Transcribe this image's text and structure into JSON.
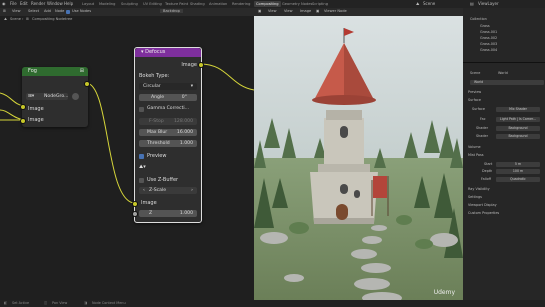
{
  "menu": [
    "File",
    "Edit",
    "Render",
    "Window",
    "Help"
  ],
  "workspaces": [
    "Layout",
    "Modeling",
    "Sculpting",
    "UV Editing",
    "Texture Paint",
    "Shading",
    "Animation",
    "Rendering",
    "Compositing",
    "Geometry Nodes",
    "Scripting"
  ],
  "active_workspace": "Compositing",
  "scene_name": "Scene",
  "view_layer_name": "ViewLayer",
  "node_header": {
    "editor_menus": [
      "View",
      "Select",
      "Add",
      "Node"
    ],
    "use_nodes_label": "Use Nodes",
    "backdrop_label": "Backdrop",
    "breadcrumb_scene": "Scene",
    "breadcrumb_tree": "Compositing Nodetree"
  },
  "fog_node": {
    "title": "Fog",
    "group_name": "NodeGro...",
    "inputs": [
      "Image",
      "Image"
    ]
  },
  "defocus_node": {
    "title": "Defocus",
    "output_label": "Image",
    "bokeh_type_label": "Bokeh Type:",
    "bokeh_type_value": "Circular",
    "angle_label": "Angle",
    "angle_value": "0°",
    "gamma_label": "Gamma Correcti...",
    "fstop_label": "F-Stop",
    "fstop_value": "128.000",
    "maxblur_label": "Max Blur",
    "maxblur_value": "16.000",
    "threshold_label": "Threshold",
    "threshold_value": "1.000",
    "preview_label": "Preview",
    "use_zbuffer_label": "Use Z-Buffer",
    "zscale_label": "Z-Scale",
    "image_input_label": "Image",
    "z_label": "Z",
    "z_value": "1.000"
  },
  "viewer_header": {
    "menus": [
      "View",
      "View",
      "Image"
    ],
    "name": "Viewer Node"
  },
  "outliner": {
    "collection": "Collection",
    "items": [
      "Grass",
      "Grass.001",
      "Grass.002",
      "Grass.003",
      "Grass.004"
    ]
  },
  "properties": {
    "scene": "Scene",
    "world": "World",
    "preview": "Preview",
    "surface": "Surface",
    "surface_value": "Mix Shader",
    "fac_label": "Fac",
    "fac_value": "Light Path | Is Camer...",
    "shader1_label": "Shader",
    "shader1_value": "Background",
    "shader2_label": "Shader",
    "shader2_value": "Background",
    "volume": "Volume",
    "mist_pass": "Mist Pass",
    "start_label": "Start",
    "start_value": "5 m",
    "depth_label": "Depth",
    "depth_value": "100 m",
    "falloff_label": "Falloff",
    "falloff_value": "Quadratic",
    "ray_visibility": "Ray Visibility",
    "settings": "Settings",
    "viewport_display": "Viewport Display",
    "custom_properties": "Custom Properties"
  },
  "status": [
    "Set Active",
    "Pan View",
    "Node Context Menu"
  ],
  "watermark": "Udemy",
  "colors": {
    "defocus_header": "#7e2f9d",
    "fog_header": "#2f6b2f",
    "socket_color": "#c7c729",
    "link_color": "#d6d63a"
  }
}
